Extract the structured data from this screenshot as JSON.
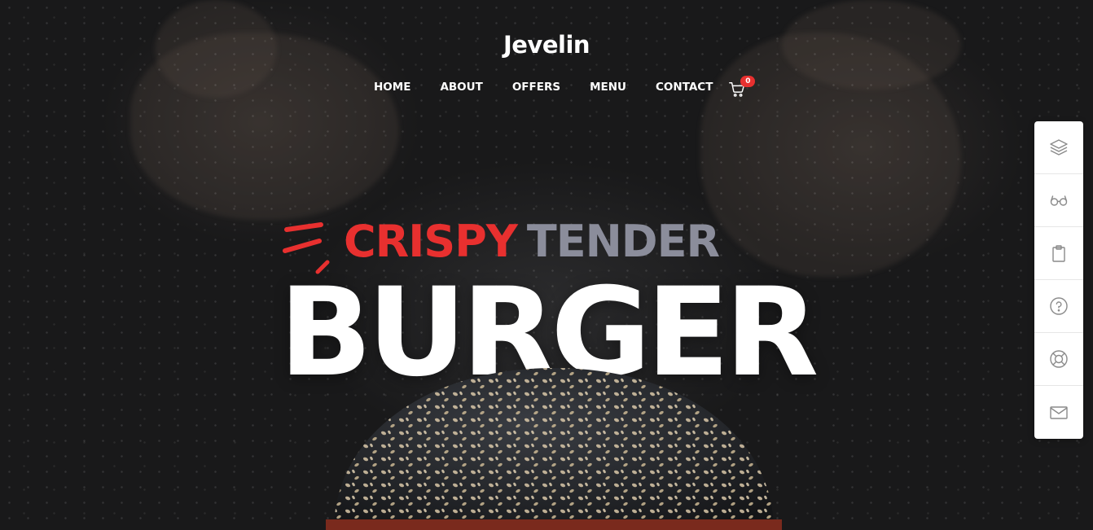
{
  "header": {
    "logo": "Jevelin",
    "nav": [
      {
        "label": "HOME"
      },
      {
        "label": "ABOUT"
      },
      {
        "label": "OFFERS"
      },
      {
        "label": "MENU"
      },
      {
        "label": "CONTACT"
      }
    ],
    "cart": {
      "icon": "cart-icon",
      "count": "0"
    }
  },
  "hero": {
    "word_red": "CRISPY",
    "word_gray": "TENDER",
    "title": "BURGER"
  },
  "sidebar": {
    "items": [
      {
        "icon": "layers-icon"
      },
      {
        "icon": "glasses-icon"
      },
      {
        "icon": "clipboard-icon"
      },
      {
        "icon": "help-circle-icon"
      },
      {
        "icon": "lifebuoy-icon"
      },
      {
        "icon": "mail-icon"
      }
    ]
  },
  "colors": {
    "accent_red": "#e8302f",
    "muted_gray": "#8b8d9b",
    "background": "#1a1a1b",
    "text_white": "#ffffff"
  }
}
